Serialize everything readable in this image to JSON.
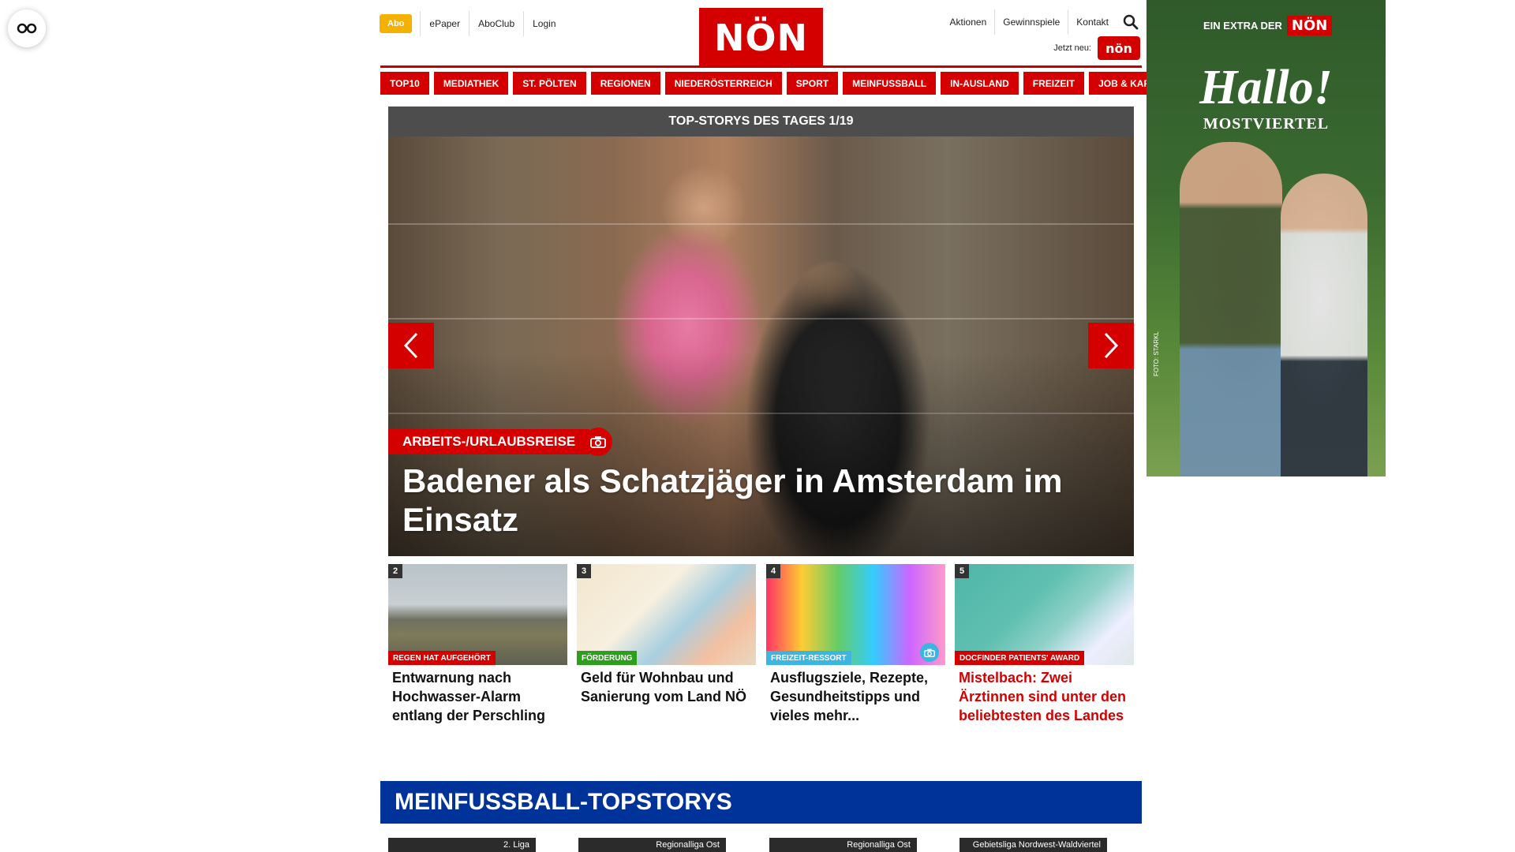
{
  "header": {
    "abo_label": "Abo",
    "top_links": [
      "ePaper",
      "AboClub",
      "Login"
    ],
    "logo_text": "NÖN",
    "right_links": [
      "Aktionen",
      "Gewinnspiele",
      "Kontakt"
    ],
    "jetzt_label": "Jetzt neu:",
    "jetzt_badge": "nön"
  },
  "nav": [
    "TOP10",
    "MEDIATHEK",
    "ST. PÖLTEN",
    "REGIONEN",
    "NIEDERÖSTERREICH",
    "SPORT",
    "MEINFUSSBALL",
    "IN-AUSLAND",
    "FREIZEIT",
    "JOB & KARRIERE"
  ],
  "hero": {
    "bar_title": "TOP-STORYS DES TAGES 1/19",
    "tag": "ARBEITS-/URLAUBSREISE",
    "title": "Badener als Schatzjäger in Amsterdam im Einsatz"
  },
  "teasers": [
    {
      "num": "2",
      "tag": "REGEN HAT AUFGEHÖRT",
      "tag_color": "#d40000",
      "title": "Entwarnung nach Hochwasser-Alarm entlang der Perschling",
      "title_red": false
    },
    {
      "num": "3",
      "tag": "FÖRDERUNG",
      "tag_color": "#2e9e1f",
      "title": "Geld für Wohnbau und Sanierung vom Land NÖ",
      "title_red": false
    },
    {
      "num": "4",
      "tag": "FREIZEIT-RESSORT",
      "tag_color": "#3cb5e0",
      "title": "Ausflugsziele, Rezepte, Gesundheitstipps und vieles mehr...",
      "title_red": false
    },
    {
      "num": "5",
      "tag": "DOCFINDER PATIENTS' AWARD",
      "tag_color": "#d40000",
      "title": "Mistelbach: Zwei Ärztinnen sind unter den beliebtesten des Landes",
      "title_red": true
    }
  ],
  "section": {
    "title": "MEINFUSSBALL-TOPSTORYS",
    "cards": [
      "2. Liga",
      "Regionalliga Ost",
      "Regionalliga Ost",
      "Gebietsliga Nordwest-Waldviertel"
    ]
  },
  "ad": {
    "extra_text": "EIN EXTRA DER",
    "extra_logo": "NÖN",
    "hallo": "Hallo!",
    "sub": "MOSTVIERTEL",
    "credit": "FOTO: STARKL"
  },
  "colors": {
    "brand_red": "#d40000",
    "abo_yellow": "#f5b100",
    "section_blue": "#003399"
  },
  "icons": [
    "glasses-icon",
    "search-icon",
    "chevron-left-icon",
    "chevron-right-icon",
    "camera-icon"
  ]
}
